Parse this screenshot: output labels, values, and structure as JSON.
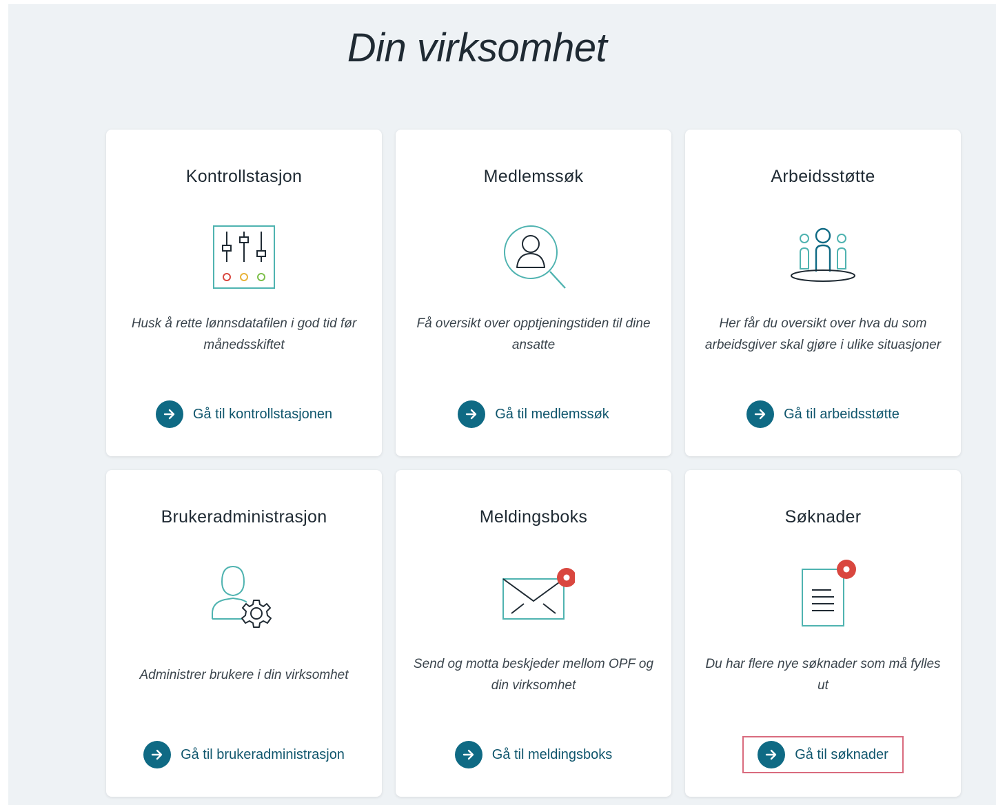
{
  "page": {
    "title": "Din virksomhet"
  },
  "colors": {
    "background": "#eef2f5",
    "accent": "#0f6a84",
    "icon_stroke": "#4fb3b0",
    "notification": "#d9473f",
    "highlight_border": "#d96b7e"
  },
  "cards": [
    {
      "title": "Kontrollstasjon",
      "icon": "control-panel-icon",
      "description": "Husk å rette lønnsdatafilen i god tid før månedsskiftet",
      "link_label": "Gå til kontrollstasjonen"
    },
    {
      "title": "Medlemssøk",
      "icon": "member-search-icon",
      "description": "Få oversikt over opptjeningstiden til dine ansatte",
      "link_label": "Gå til medlemssøk"
    },
    {
      "title": "Arbeidsstøtte",
      "icon": "people-group-icon",
      "description": "Her får du oversikt over hva du som arbeidsgiver skal gjøre i ulike situasjoner",
      "link_label": "Gå til arbeidsstøtte"
    },
    {
      "title": "Brukeradministrasjon",
      "icon": "user-settings-icon",
      "description": "Administrer brukere i din virksomhet",
      "link_label": "Gå til brukeradministrasjon"
    },
    {
      "title": "Meldingsboks",
      "icon": "envelope-notification-icon",
      "description": "Send og motta beskjeder mellom OPF og din virksomhet",
      "link_label": "Gå til meldingsboks"
    },
    {
      "title": "Søknader",
      "icon": "document-notification-icon",
      "description": "Du har flere nye søknader som må fylles ut",
      "link_label": "Gå til søknader",
      "highlighted": true
    }
  ]
}
